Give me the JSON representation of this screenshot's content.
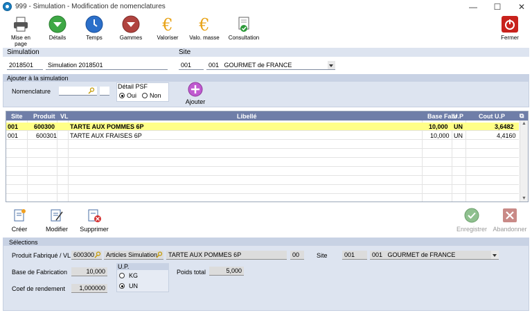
{
  "window": {
    "title": "999 - Simulation - Modification de nomenclatures",
    "minimize": "—",
    "maximize": "☐",
    "close": "✕"
  },
  "toolbar": {
    "mise_en_page": "Mise en page",
    "details": "Détails",
    "temps": "Temps",
    "gammes": "Gammes",
    "valoriser": "Valoriser",
    "valo_masse": "Valo. masse",
    "consultation": "Consultation",
    "fermer": "Fermer"
  },
  "simulation": {
    "header": "Simulation",
    "code": "2018501",
    "name": "Simulation 2018501"
  },
  "site": {
    "header": "Site",
    "code": "001",
    "select_code": "001",
    "select_name": "GOURMET de FRANCE"
  },
  "ajouter": {
    "header": "Ajouter à la simulation",
    "nomenclature_label": "Nomenclature",
    "nomenclature_value": "",
    "detail_psf_label": "Détail PSF",
    "oui": "Oui",
    "non": "Non",
    "button": "Ajouter"
  },
  "grid": {
    "headers": {
      "site": "Site",
      "produit": "Produit",
      "vl": "VL",
      "libelle": "Libellé",
      "base": "Base Fabr",
      "up": "U.P",
      "cout": "Cout U.P"
    },
    "rows": [
      {
        "site": "001",
        "produit": "600300",
        "vl": "",
        "libelle": "TARTE AUX POMMES 6P",
        "base": "10,000",
        "up": "UN",
        "cout": "3,6482"
      },
      {
        "site": "001",
        "produit": "600301",
        "vl": "",
        "libelle": "TARTE AUX FRAISES 6P",
        "base": "10,000",
        "up": "UN",
        "cout": "4,4160"
      }
    ]
  },
  "actions": {
    "creer": "Créer",
    "modifier": "Modifier",
    "supprimer": "Supprimer",
    "enregistrer": "Enregistrer",
    "abandonner": "Abandonner"
  },
  "selections": {
    "header": "Sélections",
    "produit_label": "Produit Fabriqué / VL",
    "produit_code": "600300",
    "articles": "Articles Simulation",
    "libelle": "TARTE AUX POMMES 6P",
    "vl": "00",
    "site_label": "Site",
    "site_code": "001",
    "site_select_code": "001",
    "site_select_name": "GOURMET de FRANCE",
    "base_label": "Base de Fabrication",
    "base_value": "10,000",
    "up_label": "U.P.",
    "kg": "KG",
    "un": "UN",
    "poids_label": "Poids total",
    "poids_value": "5,000",
    "coef_label": "Coef de rendement",
    "coef_value": "1,000000"
  }
}
